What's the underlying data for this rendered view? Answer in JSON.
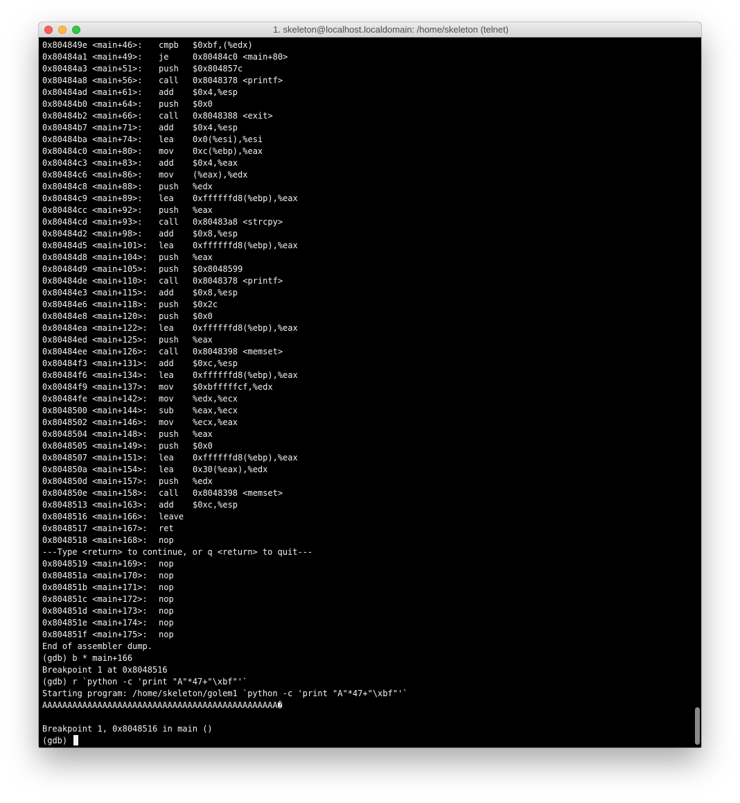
{
  "window": {
    "title": "1. skeleton@localhost.localdomain: /home/skeleton (telnet)"
  },
  "colors": {
    "terminal_bg": "#000000",
    "terminal_fg": "#f2f2f2",
    "close": "#fc605c",
    "minimize": "#fdbc40",
    "maximize": "#34c84a"
  },
  "icons": [
    "close-icon",
    "minimize-icon",
    "maximize-icon"
  ],
  "asm": [
    {
      "addr": "0x804849e <main+46>:",
      "op": "cmpb",
      "args": "$0xbf,(%edx)"
    },
    {
      "addr": "0x80484a1 <main+49>:",
      "op": "je",
      "args": "0x80484c0 <main+80>"
    },
    {
      "addr": "0x80484a3 <main+51>:",
      "op": "push",
      "args": "$0x804857c"
    },
    {
      "addr": "0x80484a8 <main+56>:",
      "op": "call",
      "args": "0x8048378 <printf>"
    },
    {
      "addr": "0x80484ad <main+61>:",
      "op": "add",
      "args": "$0x4,%esp"
    },
    {
      "addr": "0x80484b0 <main+64>:",
      "op": "push",
      "args": "$0x0"
    },
    {
      "addr": "0x80484b2 <main+66>:",
      "op": "call",
      "args": "0x8048388 <exit>"
    },
    {
      "addr": "0x80484b7 <main+71>:",
      "op": "add",
      "args": "$0x4,%esp"
    },
    {
      "addr": "0x80484ba <main+74>:",
      "op": "lea",
      "args": "0x0(%esi),%esi"
    },
    {
      "addr": "0x80484c0 <main+80>:",
      "op": "mov",
      "args": "0xc(%ebp),%eax"
    },
    {
      "addr": "0x80484c3 <main+83>:",
      "op": "add",
      "args": "$0x4,%eax"
    },
    {
      "addr": "0x80484c6 <main+86>:",
      "op": "mov",
      "args": "(%eax),%edx"
    },
    {
      "addr": "0x80484c8 <main+88>:",
      "op": "push",
      "args": "%edx"
    },
    {
      "addr": "0x80484c9 <main+89>:",
      "op": "lea",
      "args": "0xffffffd8(%ebp),%eax"
    },
    {
      "addr": "0x80484cc <main+92>:",
      "op": "push",
      "args": "%eax"
    },
    {
      "addr": "0x80484cd <main+93>:",
      "op": "call",
      "args": "0x80483a8 <strcpy>"
    },
    {
      "addr": "0x80484d2 <main+98>:",
      "op": "add",
      "args": "$0x8,%esp"
    },
    {
      "addr": "0x80484d5 <main+101>:",
      "op": "lea",
      "args": "0xffffffd8(%ebp),%eax"
    },
    {
      "addr": "0x80484d8 <main+104>:",
      "op": "push",
      "args": "%eax"
    },
    {
      "addr": "0x80484d9 <main+105>:",
      "op": "push",
      "args": "$0x8048599"
    },
    {
      "addr": "0x80484de <main+110>:",
      "op": "call",
      "args": "0x8048378 <printf>"
    },
    {
      "addr": "0x80484e3 <main+115>:",
      "op": "add",
      "args": "$0x8,%esp"
    },
    {
      "addr": "0x80484e6 <main+118>:",
      "op": "push",
      "args": "$0x2c"
    },
    {
      "addr": "0x80484e8 <main+120>:",
      "op": "push",
      "args": "$0x0"
    },
    {
      "addr": "0x80484ea <main+122>:",
      "op": "lea",
      "args": "0xffffffd8(%ebp),%eax"
    },
    {
      "addr": "0x80484ed <main+125>:",
      "op": "push",
      "args": "%eax"
    },
    {
      "addr": "0x80484ee <main+126>:",
      "op": "call",
      "args": "0x8048398 <memset>"
    },
    {
      "addr": "0x80484f3 <main+131>:",
      "op": "add",
      "args": "$0xc,%esp"
    },
    {
      "addr": "0x80484f6 <main+134>:",
      "op": "lea",
      "args": "0xffffffd8(%ebp),%eax"
    },
    {
      "addr": "0x80484f9 <main+137>:",
      "op": "mov",
      "args": "$0xbfffffcf,%edx"
    },
    {
      "addr": "0x80484fe <main+142>:",
      "op": "mov",
      "args": "%edx,%ecx"
    },
    {
      "addr": "0x8048500 <main+144>:",
      "op": "sub",
      "args": "%eax,%ecx"
    },
    {
      "addr": "0x8048502 <main+146>:",
      "op": "mov",
      "args": "%ecx,%eax"
    },
    {
      "addr": "0x8048504 <main+148>:",
      "op": "push",
      "args": "%eax"
    },
    {
      "addr": "0x8048505 <main+149>:",
      "op": "push",
      "args": "$0x0"
    },
    {
      "addr": "0x8048507 <main+151>:",
      "op": "lea",
      "args": "0xffffffd8(%ebp),%eax"
    },
    {
      "addr": "0x804850a <main+154>:",
      "op": "lea",
      "args": "0x30(%eax),%edx"
    },
    {
      "addr": "0x804850d <main+157>:",
      "op": "push",
      "args": "%edx"
    },
    {
      "addr": "0x804850e <main+158>:",
      "op": "call",
      "args": "0x8048398 <memset>"
    },
    {
      "addr": "0x8048513 <main+163>:",
      "op": "add",
      "args": "$0xc,%esp"
    },
    {
      "addr": "0x8048516 <main+166>:",
      "op": "leave",
      "args": ""
    },
    {
      "addr": "0x8048517 <main+167>:",
      "op": "ret",
      "args": ""
    },
    {
      "addr": "0x8048518 <main+168>:",
      "op": "nop",
      "args": ""
    }
  ],
  "pager_prompt": "---Type <return> to continue, or q <return> to quit---",
  "asm2": [
    {
      "addr": "0x8048519 <main+169>:",
      "op": "nop",
      "args": ""
    },
    {
      "addr": "0x804851a <main+170>:",
      "op": "nop",
      "args": ""
    },
    {
      "addr": "0x804851b <main+171>:",
      "op": "nop",
      "args": ""
    },
    {
      "addr": "0x804851c <main+172>:",
      "op": "nop",
      "args": ""
    },
    {
      "addr": "0x804851d <main+173>:",
      "op": "nop",
      "args": ""
    },
    {
      "addr": "0x804851e <main+174>:",
      "op": "nop",
      "args": ""
    },
    {
      "addr": "0x804851f <main+175>:",
      "op": "nop",
      "args": ""
    }
  ],
  "tail": [
    "End of assembler dump.",
    "(gdb) b * main+166",
    "Breakpoint 1 at 0x8048516",
    "(gdb) r `python -c 'print \"A\"*47+\"\\xbf\"'`",
    "Starting program: /home/skeleton/golem1 `python -c 'print \"A\"*47+\"\\xbf\"'`",
    "AAAAAAAAAAAAAAAAAAAAAAAAAAAAAAAAAAAAAAAAAAAAAAA�",
    "",
    "Breakpoint 1, 0x8048516 in main ()"
  ],
  "prompt": "(gdb) "
}
